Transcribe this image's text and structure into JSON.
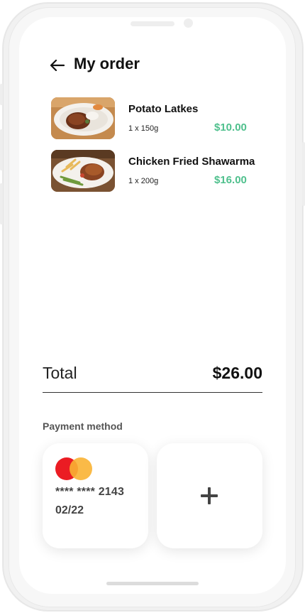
{
  "header": {
    "title": "My order"
  },
  "order_items": [
    {
      "name": "Potato Latkes",
      "quantity": "1 x 150g",
      "price": "$10.00"
    },
    {
      "name": "Chicken Fried Shawarma",
      "quantity": "1 x 200g",
      "price": "$16.00"
    }
  ],
  "summary": {
    "total_label": "Total",
    "total_value": "$26.00"
  },
  "payment": {
    "section_label": "Payment method",
    "card_number": "**** **** 2143",
    "card_expiry": "02/22",
    "card_brand_icon": "mastercard-icon",
    "add_icon": "plus-icon"
  },
  "colors": {
    "price_green": "#4fc08d",
    "mastercard_red": "#eb1c23",
    "mastercard_yellow": "#f9b233"
  }
}
